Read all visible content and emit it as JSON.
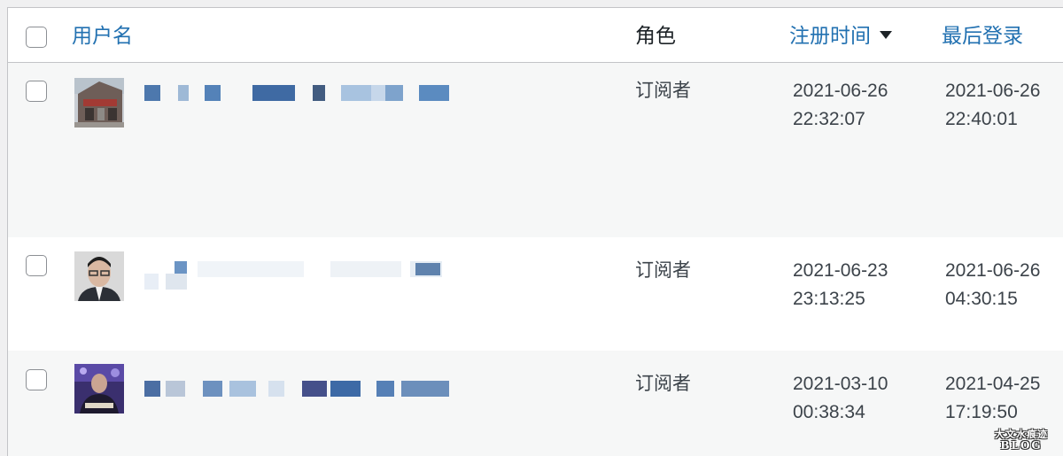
{
  "header": {
    "username_label": "用户名",
    "role_label": "角色",
    "registered_label": "注册时间",
    "last_login_label": "最后登录"
  },
  "rows": [
    {
      "role": "订阅者",
      "registered_date": "2021-06-26",
      "registered_time": "22:32:07",
      "last_login_date": "2021-06-26",
      "last_login_time": "22:40:01"
    },
    {
      "role": "订阅者",
      "registered_date": "2021-06-23",
      "registered_time": "23:13:25",
      "last_login_date": "2021-06-26",
      "last_login_time": "04:30:15"
    },
    {
      "role": "订阅者",
      "registered_date": "2021-03-10",
      "registered_time": "00:38:34",
      "last_login_date": "2021-04-25",
      "last_login_time": "17:19:50"
    }
  ],
  "watermark": {
    "line1": "大文水痕迹",
    "line2": "BLOG"
  },
  "colors": {
    "link": "#2271b1",
    "row_alt": "#f6f7f7",
    "border": "#c3c4c7"
  }
}
